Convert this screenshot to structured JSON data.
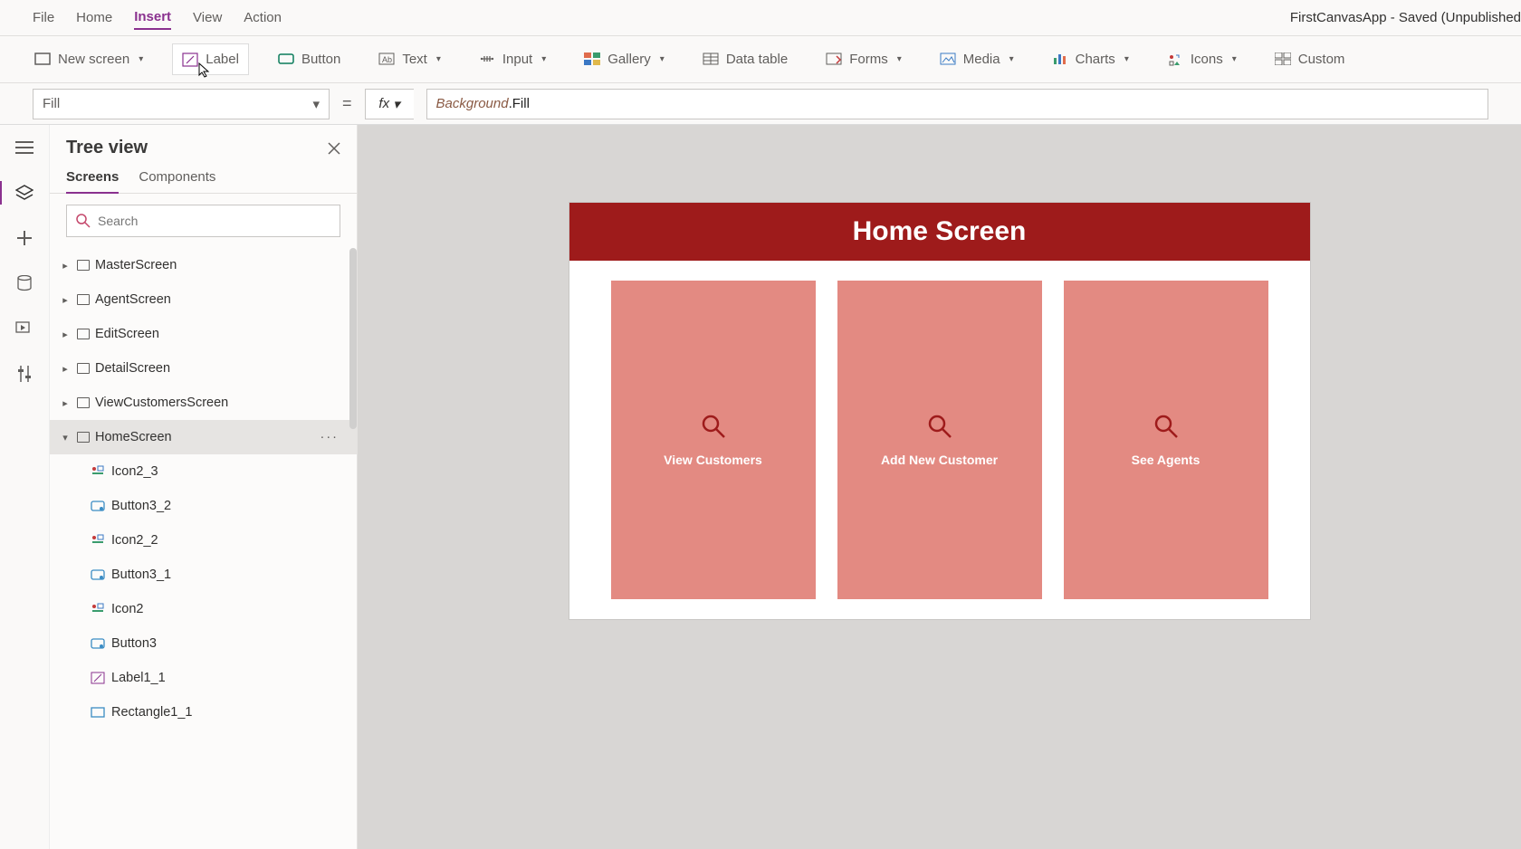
{
  "app_title": "FirstCanvasApp - Saved (Unpublished",
  "menubar": {
    "file": "File",
    "home": "Home",
    "insert": "Insert",
    "view": "View",
    "action": "Action"
  },
  "ribbon": {
    "new_screen": "New screen",
    "label": "Label",
    "button": "Button",
    "text": "Text",
    "input": "Input",
    "gallery": "Gallery",
    "data_table": "Data table",
    "forms": "Forms",
    "media": "Media",
    "charts": "Charts",
    "icons": "Icons",
    "custom": "Custom"
  },
  "formula": {
    "property": "Fill",
    "fx": "fx",
    "token_obj": "Background",
    "token_rest": ".Fill"
  },
  "treeview": {
    "title": "Tree view",
    "tab_screens": "Screens",
    "tab_components": "Components",
    "search_placeholder": "Search",
    "items": {
      "master": "MasterScreen",
      "agent": "AgentScreen",
      "edit": "EditScreen",
      "detail": "DetailScreen",
      "viewcust": "ViewCustomersScreen",
      "home": "HomeScreen"
    },
    "children": {
      "icon2_3": "Icon2_3",
      "button3_2": "Button3_2",
      "icon2_2": "Icon2_2",
      "button3_1": "Button3_1",
      "icon2": "Icon2",
      "button3": "Button3",
      "label1_1": "Label1_1",
      "rect1_1": "Rectangle1_1"
    }
  },
  "canvas": {
    "header": "Home Screen",
    "cards": {
      "view_customers": "View Customers",
      "add_customer": "Add New Customer",
      "see_agents": "See Agents"
    }
  }
}
